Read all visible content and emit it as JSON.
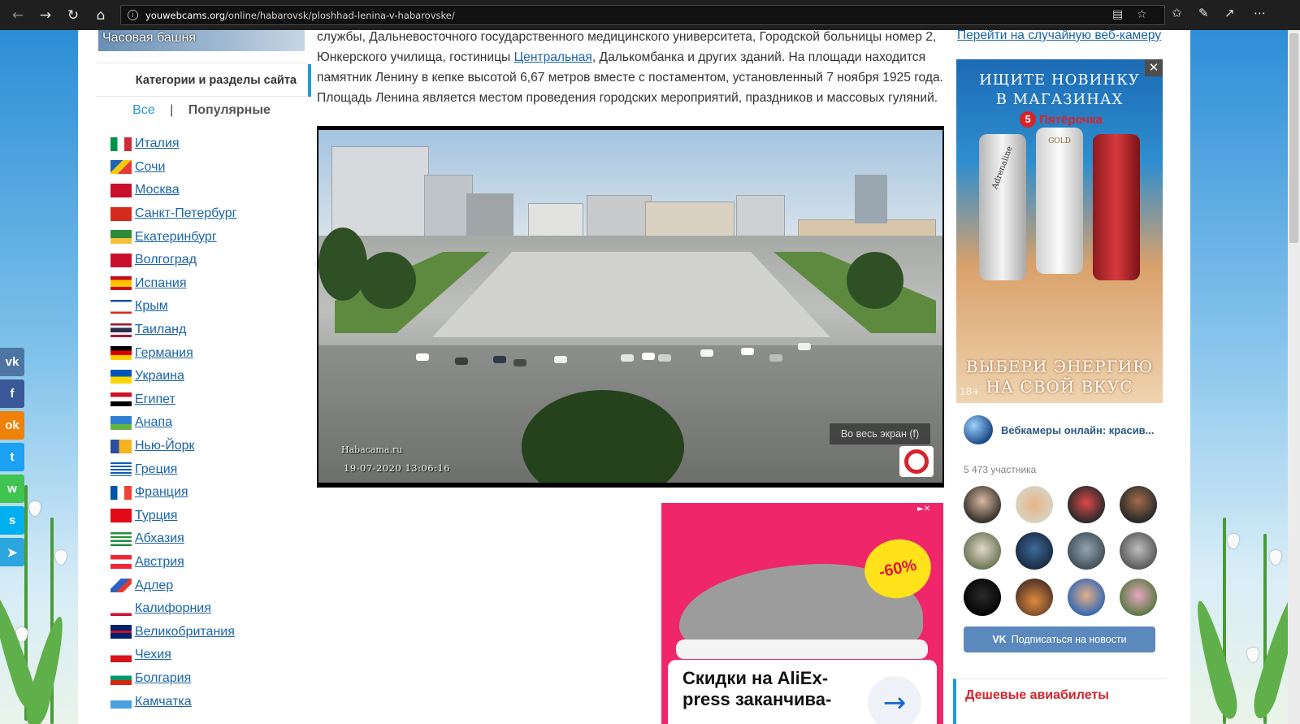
{
  "browser": {
    "url_domain": "youwebcams.org",
    "url_path": "/online/habarovsk/ploshhad-lenina-v-habarovske/"
  },
  "sidebar": {
    "thumb_title": "Часовая башня",
    "categories_title": "Категории и разделы сайта",
    "tab_all": "Все",
    "tab_separator": "|",
    "tab_popular": "Популярные",
    "items": [
      {
        "label": "Италия",
        "flag": "italy"
      },
      {
        "label": "Сочи",
        "flag": "sochi"
      },
      {
        "label": "Москва",
        "flag": "moscow"
      },
      {
        "label": "Санкт-Петербург",
        "flag": "spb"
      },
      {
        "label": "Екатеринбург",
        "flag": "ekb"
      },
      {
        "label": "Волгоград",
        "flag": "volgograd"
      },
      {
        "label": "Испания",
        "flag": "spain"
      },
      {
        "label": "Крым",
        "flag": "crimea"
      },
      {
        "label": "Таиланд",
        "flag": "thailand"
      },
      {
        "label": "Германия",
        "flag": "germany"
      },
      {
        "label": "Украина",
        "flag": "ukraine"
      },
      {
        "label": "Египет",
        "flag": "egypt"
      },
      {
        "label": "Анапа",
        "flag": "anapa"
      },
      {
        "label": "Нью-Йорк",
        "flag": "newyork"
      },
      {
        "label": "Греция",
        "flag": "greece"
      },
      {
        "label": "Франция",
        "flag": "france"
      },
      {
        "label": "Турция",
        "flag": "turkey"
      },
      {
        "label": "Абхазия",
        "flag": "abkhazia"
      },
      {
        "label": "Австрия",
        "flag": "austria"
      },
      {
        "label": "Адлер",
        "flag": "adler"
      },
      {
        "label": "Калифорния",
        "flag": "california"
      },
      {
        "label": "Великобритания",
        "flag": "uk"
      },
      {
        "label": "Чехия",
        "flag": "czech"
      },
      {
        "label": "Болгария",
        "flag": "bulgaria"
      },
      {
        "label": "Камчатка",
        "flag": "kamchatka"
      }
    ]
  },
  "article": {
    "p1_text_a": "службы, Дальневосточного государственного медицинского университета, Городской больницы номер 2, Юнкерского училища, гостиницы ",
    "p1_link": "Центральная",
    "p1_text_b": ", Далькомбанка и других зданий. На площади находится памятник Ленину в кепке высотой 6,67 метров вместе с постаментом, установленный 7 ноября 1925 года. Площадь Ленина является местом проведения городских мероприятий, праздников и массовых гуляний."
  },
  "webcam": {
    "fullscreen_label": "Во весь экран (f)",
    "brand_watermark": "Habacama.ru",
    "timestamp": "19-07-2020 13:06:16"
  },
  "ad_ali": {
    "discount": "-60%",
    "headline_line1": "Скидки на AliEx-",
    "headline_line2": "press заканчива-"
  },
  "right": {
    "random_link": "Перейти на случайную веб-камеру",
    "pad_ad": {
      "heading_line1": "ИЩИТЕ НОВИНКУ",
      "heading_line2": "В МАГАЗИНАХ",
      "store_digit": "5",
      "store_name": "Пятёрочка",
      "can_text": "Adrenaline",
      "can_sub": "GOLD",
      "footer_line1": "ВЫБЕРИ ЭНЕРГИЮ",
      "footer_line2": "НА СВОЙ ВКУС",
      "age": "18+"
    },
    "vk": {
      "group_name": "Вебкамеры онлайн: красив...",
      "members": "5 473 участника",
      "subscribe_label": "Подписаться на новости",
      "vk_logo": "VK"
    },
    "cheap_flights": "Дешевые авиабилеты"
  },
  "share_bar": [
    "vk",
    "facebook",
    "odnoklassniki",
    "twitter",
    "whatsapp",
    "skype",
    "telegram"
  ],
  "colors": {
    "link": "#1a64a8",
    "accent": "#1e9ad6",
    "vk_button": "#5b88bd",
    "red": "#d8232a"
  }
}
